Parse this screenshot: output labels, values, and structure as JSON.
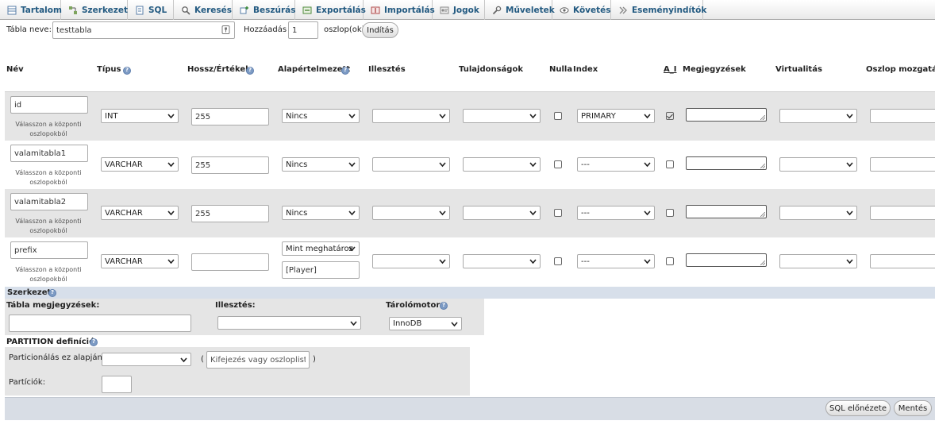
{
  "tabs": [
    {
      "label": "Tartalom",
      "icon": "browse-icon"
    },
    {
      "label": "Szerkezet",
      "icon": "structure-icon"
    },
    {
      "label": "SQL",
      "icon": "sql-icon"
    },
    {
      "label": "Keresés",
      "icon": "search-icon"
    },
    {
      "label": "Beszúrás",
      "icon": "insert-icon"
    },
    {
      "label": "Exportálás",
      "icon": "export-icon"
    },
    {
      "label": "Importálás",
      "icon": "import-icon"
    },
    {
      "label": "Jogok",
      "icon": "privileges-icon"
    },
    {
      "label": "Műveletek",
      "icon": "operations-icon"
    },
    {
      "label": "Követés",
      "icon": "tracking-icon"
    },
    {
      "label": "Eseményindítók",
      "icon": "triggers-icon"
    }
  ],
  "table_name": {
    "label": "Tábla neve:",
    "value": "testtabla"
  },
  "add": {
    "label": "Hozzáadás",
    "value": "1",
    "suffix": "oszlop(ok)",
    "button": "Indítás"
  },
  "columns_header": {
    "name": "Név",
    "type": "Típus",
    "length": "Hossz/Értékek",
    "default": "Alapértelmezett",
    "collation": "Illesztés",
    "attributes": "Tulajdonságok",
    "null": "Nulla",
    "index": "Index",
    "ai": "A_I",
    "comments": "Megjegyzések",
    "virtuality": "Virtualitás",
    "move": "Oszlop mozgatása"
  },
  "central_hint": {
    "line1": "Válasszon a központi",
    "line2": "oszlopokból"
  },
  "rows": [
    {
      "name": "id",
      "type": "INT",
      "length": "255",
      "default": "Nincs",
      "default_value": "",
      "null": false,
      "index": "PRIMARY",
      "ai": true
    },
    {
      "name": "valamitabla1",
      "type": "VARCHAR",
      "length": "255",
      "default": "Nincs",
      "default_value": "",
      "null": false,
      "index": "---",
      "ai": false
    },
    {
      "name": "valamitabla2",
      "type": "VARCHAR",
      "length": "255",
      "default": "Nincs",
      "default_value": "",
      "null": false,
      "index": "---",
      "ai": false
    },
    {
      "name": "prefix",
      "type": "VARCHAR",
      "length": "",
      "default": "Mint meghatároz",
      "default_value": "[Player]",
      "null": false,
      "index": "---",
      "ai": false
    }
  ],
  "structure": {
    "label": "Szerkezet",
    "table_comments": "Tábla megjegyzések:",
    "collation": "Illesztés:",
    "engine_label": "Tárolómotor:",
    "engine": "InnoDB"
  },
  "partition": {
    "label": "PARTITION definíció:",
    "by": "Particionálás ez alapján:",
    "open_paren": "(",
    "placeholder": "Kifejezés vagy oszloplista",
    "close_paren": ")",
    "partitions": "Partíciók:"
  },
  "footer": {
    "preview": "SQL előnézete",
    "save": "Mentés"
  },
  "colors": {
    "tab_text": "#235a81",
    "row_gray": "#e5e5e5",
    "section_blue": "#d7dfea",
    "footer_bg": "#d8dde5"
  }
}
